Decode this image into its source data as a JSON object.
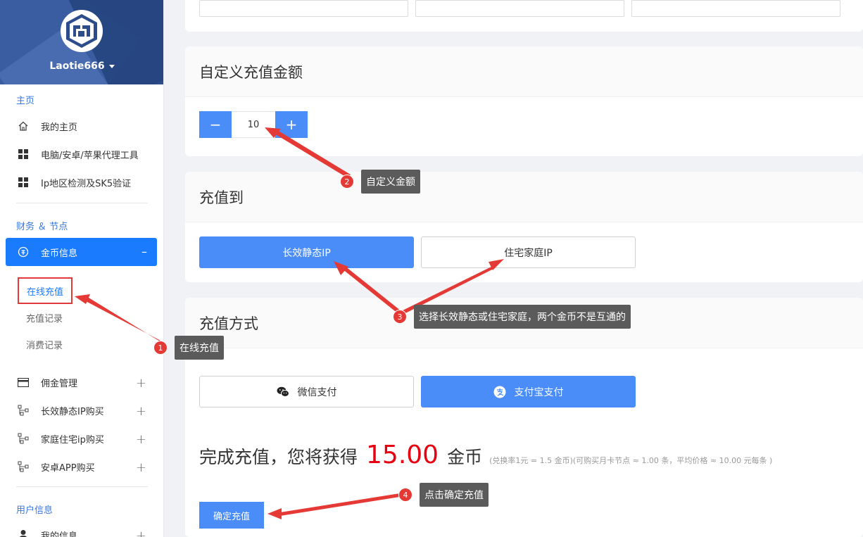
{
  "sidebar": {
    "username": "Laotie666",
    "sections": {
      "home": "主页",
      "finance": "财务 ＆ 节点",
      "user": "用户信息"
    },
    "home_items": [
      {
        "label": "我的主页",
        "icon": "home-icon"
      },
      {
        "label": "电脑/安卓/苹果代理工具",
        "icon": "grid-icon"
      },
      {
        "label": "Ip地区检测及SK5验证",
        "icon": "grid-icon"
      }
    ],
    "active_item": {
      "label": "金币信息",
      "icon": "coin-icon"
    },
    "sub_items": [
      "在线充值",
      "充值记录",
      "消费记录"
    ],
    "finance_items": [
      {
        "label": "佣金管理",
        "icon": "card-icon"
      },
      {
        "label": "长效静态IP购买",
        "icon": "network-icon"
      },
      {
        "label": "家庭住宅ip购买",
        "icon": "network-icon"
      },
      {
        "label": "安卓APP购买",
        "icon": "network-icon"
      }
    ],
    "user_items": [
      {
        "label": "我的信息",
        "icon": "user-icon"
      }
    ]
  },
  "main": {
    "custom_amount": {
      "title": "自定义充值金额",
      "value": "10",
      "minus": "−",
      "plus": "+"
    },
    "recharge_to": {
      "title": "充值到",
      "options": [
        "长效静态IP",
        "住宅家庭IP"
      ],
      "selected": 0
    },
    "pay_method": {
      "title": "充值方式",
      "options": [
        {
          "label": "微信支付",
          "icon": "wechat-icon"
        },
        {
          "label": "支付宝支付",
          "icon": "alipay-icon"
        }
      ],
      "selected": 1
    },
    "result": {
      "prefix": "完成充值，您将获得",
      "amount": "15.00",
      "unit": "金币",
      "note": "(兑换率1元 = 1.5 金币)(可购买月卡节点 ≈ 1.00 条，平均价格 ≈ 10.00 元每条 )"
    },
    "confirm_label": "确定充值"
  },
  "annotations": [
    {
      "num": "1",
      "text": "在线充值"
    },
    {
      "num": "2",
      "text": "自定义金额"
    },
    {
      "num": "3",
      "text": "选择长效静态或住宅家庭，两个金币不是互通的"
    },
    {
      "num": "4",
      "text": "点击确定充值"
    }
  ],
  "colors": {
    "primary": "#4b8df8",
    "active_nav": "#1a7bff",
    "amount_red": "#e60012",
    "annotation_red": "#e53935"
  }
}
